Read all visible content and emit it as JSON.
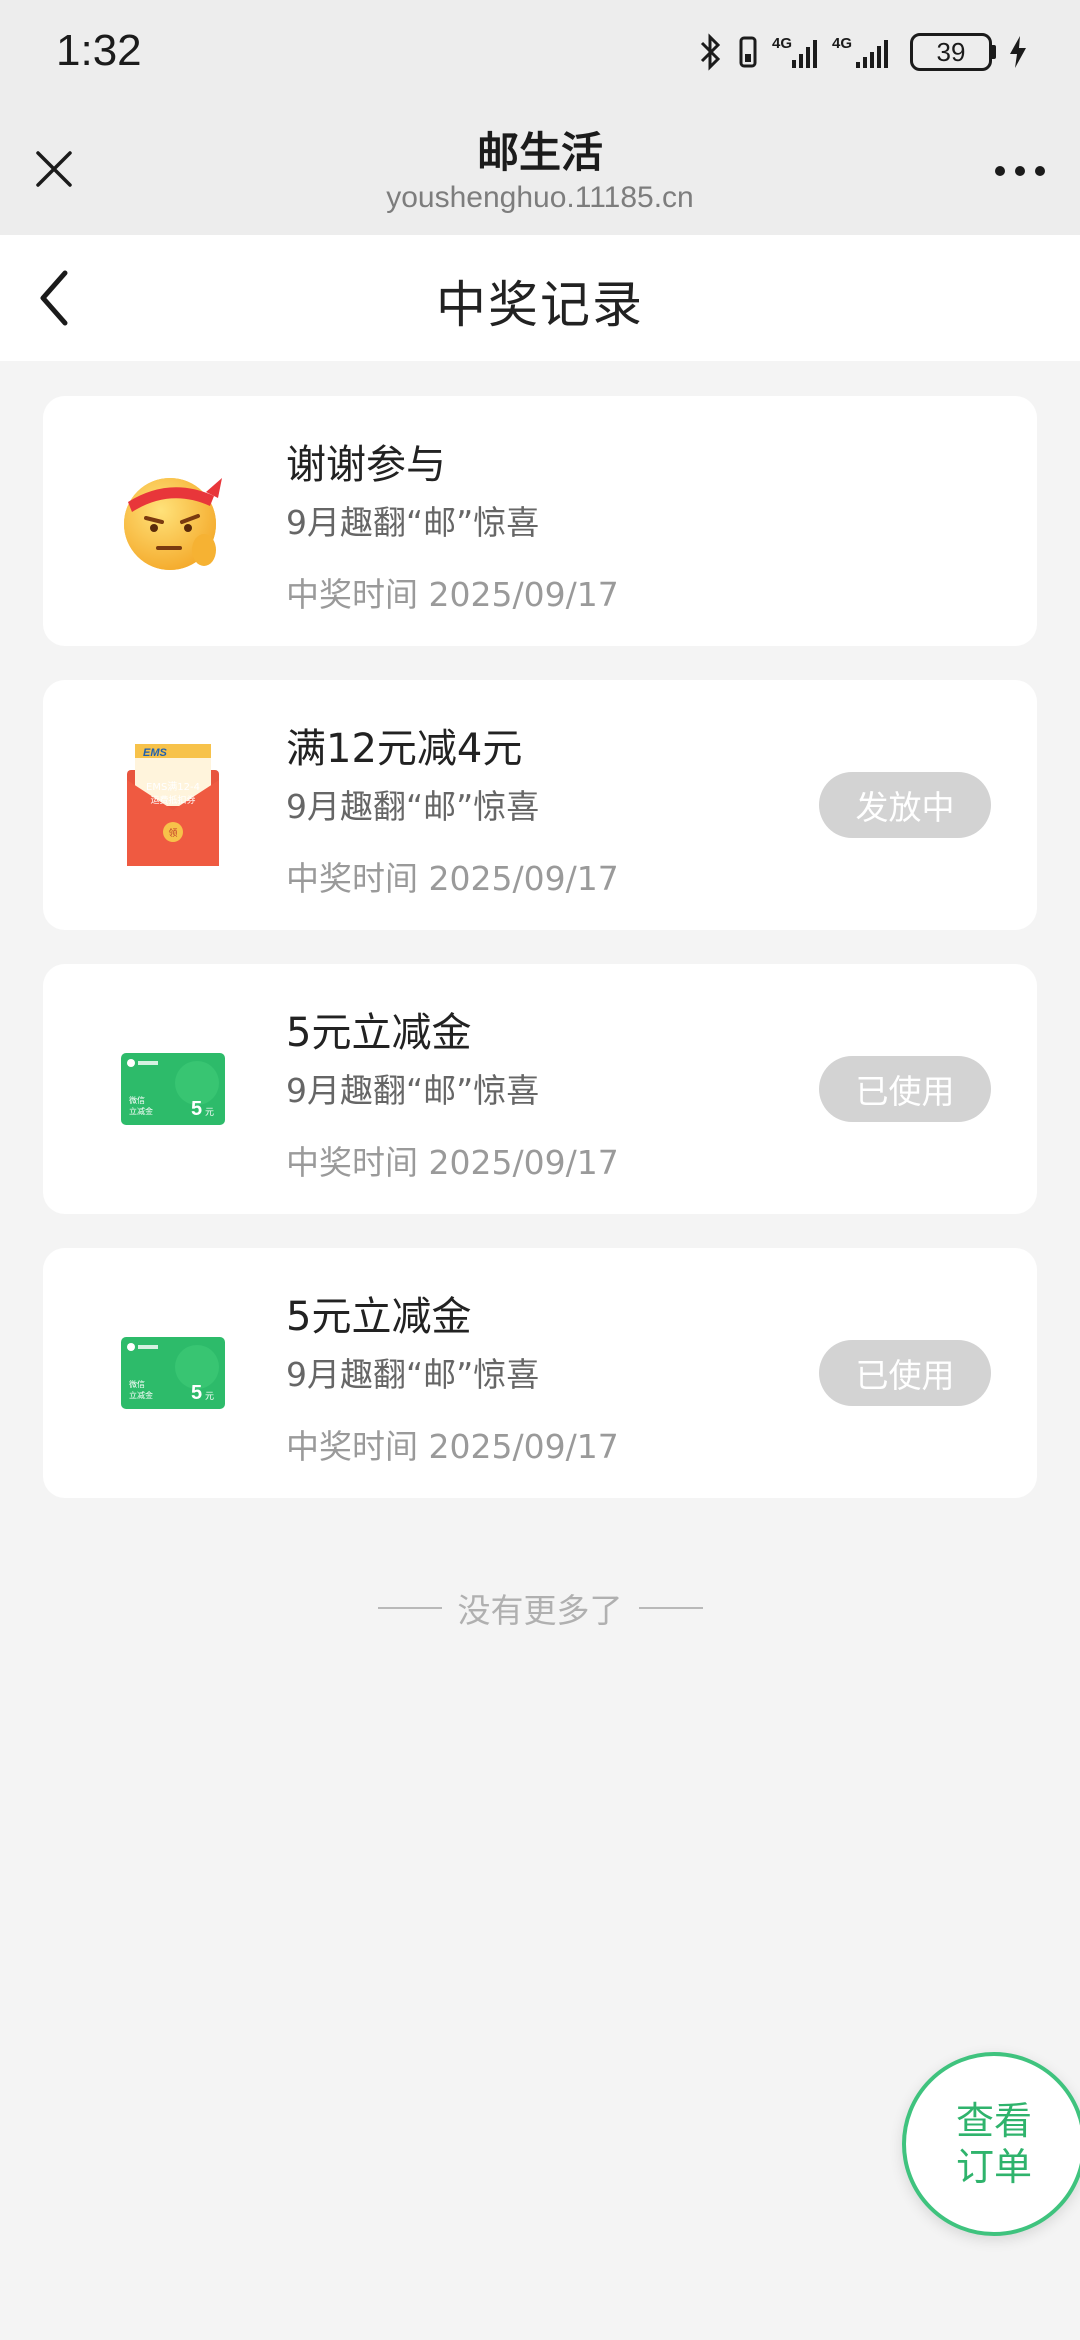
{
  "status_bar": {
    "time": "1:32",
    "battery": "39",
    "icons": [
      "bluetooth-icon",
      "vibrate-icon",
      "signal-4g-icon",
      "signal-4g-icon",
      "charging-icon"
    ]
  },
  "web_bar": {
    "title": "邮生活",
    "url": "youshenghuo.11185.cn"
  },
  "nav": {
    "title": "中奖记录"
  },
  "records": [
    {
      "title": "谢谢参与",
      "subtitle": "9月趣翻“邮”惊喜",
      "time": "中奖时间 2025/09/17",
      "status": null,
      "thumb": "emoji-face-icon"
    },
    {
      "title": "满12元减4元",
      "subtitle": "9月趣翻“邮”惊喜",
      "time": "中奖时间 2025/09/17",
      "status": "发放中",
      "thumb": "ems-red-envelope-icon",
      "thumb_text": {
        "brand": "EMS",
        "line1": "EMS满12-4",
        "line2": "运费抵扣券",
        "seal": "领"
      }
    },
    {
      "title": "5元立减金",
      "subtitle": "9月趣翻“邮”惊喜",
      "time": "中奖时间 2025/09/17",
      "status": "已使用",
      "thumb": "wechat-pay-card-icon",
      "thumb_text": {
        "line1": "微信",
        "line2": "立减金",
        "amount": "5",
        "unit": "元"
      }
    },
    {
      "title": "5元立减金",
      "subtitle": "9月趣翻“邮”惊喜",
      "time": "中奖时间 2025/09/17",
      "status": "已使用",
      "thumb": "wechat-pay-card-icon",
      "thumb_text": {
        "line1": "微信",
        "line2": "立减金",
        "amount": "5",
        "unit": "元"
      }
    }
  ],
  "footer": {
    "no_more": "没有更多了"
  },
  "fab": {
    "line1": "查看",
    "line2": "订单"
  },
  "colors": {
    "accent": "#3fc37e",
    "pill": "#d3d3d3",
    "card_green": "#2dbb6a",
    "envelope_red": "#e8553e"
  }
}
